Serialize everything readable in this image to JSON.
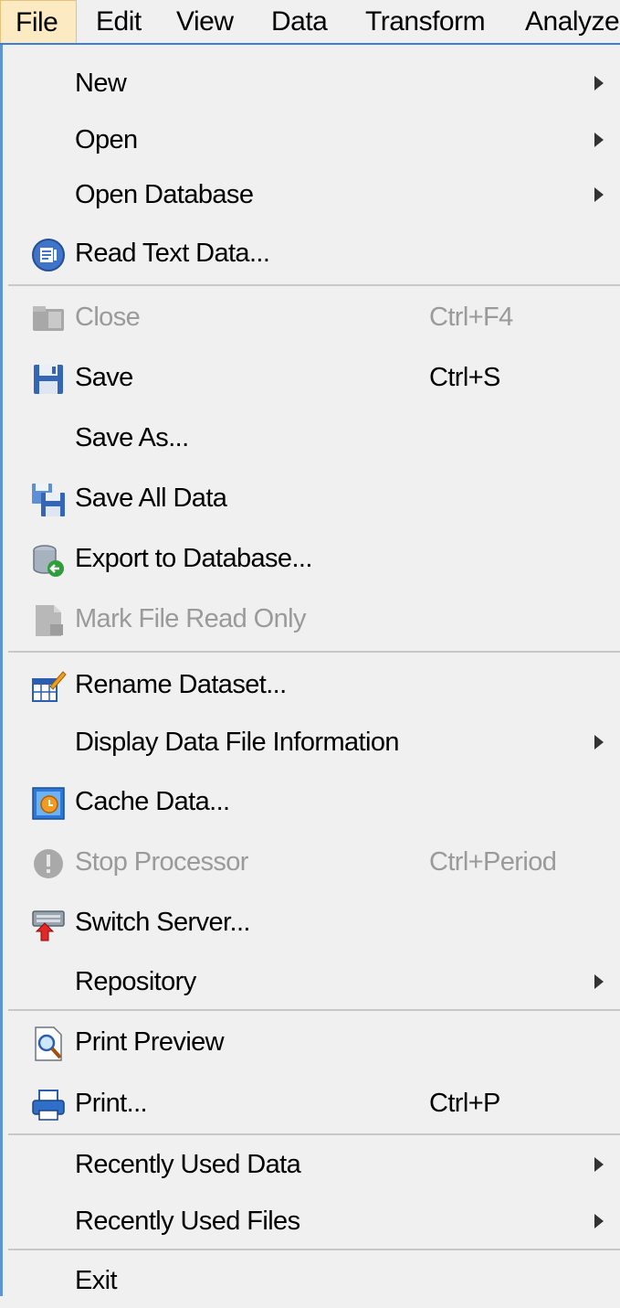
{
  "menubar": {
    "items": [
      {
        "label": "File",
        "active": true
      },
      {
        "label": "Edit"
      },
      {
        "label": "View"
      },
      {
        "label": "Data"
      },
      {
        "label": "Transform"
      },
      {
        "label": "Analyze"
      }
    ]
  },
  "file_menu": {
    "items": [
      {
        "label": "New",
        "submenu": true
      },
      {
        "label": "Open",
        "submenu": true
      },
      {
        "label": "Open Database",
        "submenu": true
      },
      {
        "label": "Read Text Data...",
        "icon": "read-text-data-icon"
      },
      {
        "label": "Close",
        "shortcut": "Ctrl+F4",
        "disabled": true,
        "icon": "close-file-icon"
      },
      {
        "label": "Save",
        "shortcut": "Ctrl+S",
        "icon": "save-icon"
      },
      {
        "label": "Save As..."
      },
      {
        "label": "Save All Data",
        "icon": "save-all-icon"
      },
      {
        "label": "Export to Database...",
        "icon": "export-database-icon"
      },
      {
        "label": "Mark File Read Only",
        "disabled": true,
        "icon": "read-only-icon"
      },
      {
        "label": "Rename Dataset...",
        "icon": "rename-dataset-icon"
      },
      {
        "label": "Display Data File Information",
        "submenu": true
      },
      {
        "label": "Cache Data...",
        "icon": "cache-data-icon"
      },
      {
        "label": "Stop Processor",
        "shortcut": "Ctrl+Period",
        "disabled": true,
        "icon": "stop-processor-icon"
      },
      {
        "label": "Switch Server...",
        "icon": "switch-server-icon"
      },
      {
        "label": "Repository",
        "submenu": true
      },
      {
        "label": "Print Preview",
        "icon": "print-preview-icon"
      },
      {
        "label": "Print...",
        "shortcut": "Ctrl+P",
        "icon": "print-icon"
      },
      {
        "label": "Recently Used Data",
        "submenu": true
      },
      {
        "label": "Recently Used Files",
        "submenu": true
      },
      {
        "label": "Exit"
      }
    ]
  },
  "colors": {
    "accent": "#3a7fd5",
    "active_menu_bg": "#fcebc2",
    "disabled_text": "#9a9a9a"
  }
}
